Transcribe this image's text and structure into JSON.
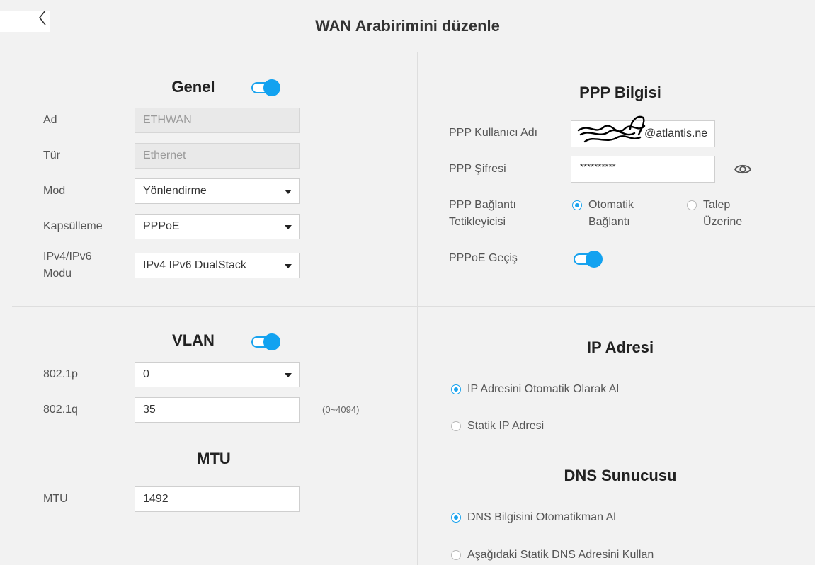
{
  "header": {
    "title": "WAN Arabirimini düzenle",
    "back_icon": "chevron-left-icon"
  },
  "general": {
    "title": "Genel",
    "enabled": true,
    "name_label": "Ad",
    "name_value": "ETHWAN",
    "type_label": "Tür",
    "type_value": "Ethernet",
    "mode_label": "Mod",
    "mode_value": "Yönlendirme",
    "encap_label": "Kapsülleme",
    "encap_value": "PPPoE",
    "ipmode_label_1": "IPv4/IPv6",
    "ipmode_label_2": "Modu",
    "ipmode_value": "IPv4 IPv6 DualStack"
  },
  "vlan": {
    "title": "VLAN",
    "enabled": true,
    "p_label": "802.1p",
    "p_value": "0",
    "q_label": "802.1q",
    "q_value": "35",
    "q_hint": "(0~4094)"
  },
  "mtu": {
    "title": "MTU",
    "label": "MTU",
    "value": "1492"
  },
  "ppp": {
    "title": "PPP Bilgisi",
    "user_label": "PPP Kullanıcı Adı",
    "user_value_visible": "@atlantis.ne",
    "pass_label": "PPP Şifresi",
    "pass_value": "**********",
    "trigger_label_1": "PPP Bağlantı",
    "trigger_label_2": "Tetikleyicisi",
    "auto_1": "Otomatik",
    "auto_2": "Bağlantı",
    "demand_1": "Talep",
    "demand_2": "Üzerine",
    "trigger_selected": "auto",
    "passthrough_label": "PPPoE Geçiş",
    "passthrough_enabled": true
  },
  "ip": {
    "title": "IP Adresi",
    "auto_label": "IP Adresini Otomatik Olarak Al",
    "static_label": "Statik IP Adresi",
    "selected": "auto"
  },
  "dns": {
    "title": "DNS Sunucusu",
    "auto_label": "DNS Bilgisini Otomatikman Al",
    "static_label": "Aşağıdaki Statik DNS Adresini Kullan",
    "selected": "auto"
  },
  "colors": {
    "accent": "#12a2f0",
    "background": "#f2f2f2"
  }
}
